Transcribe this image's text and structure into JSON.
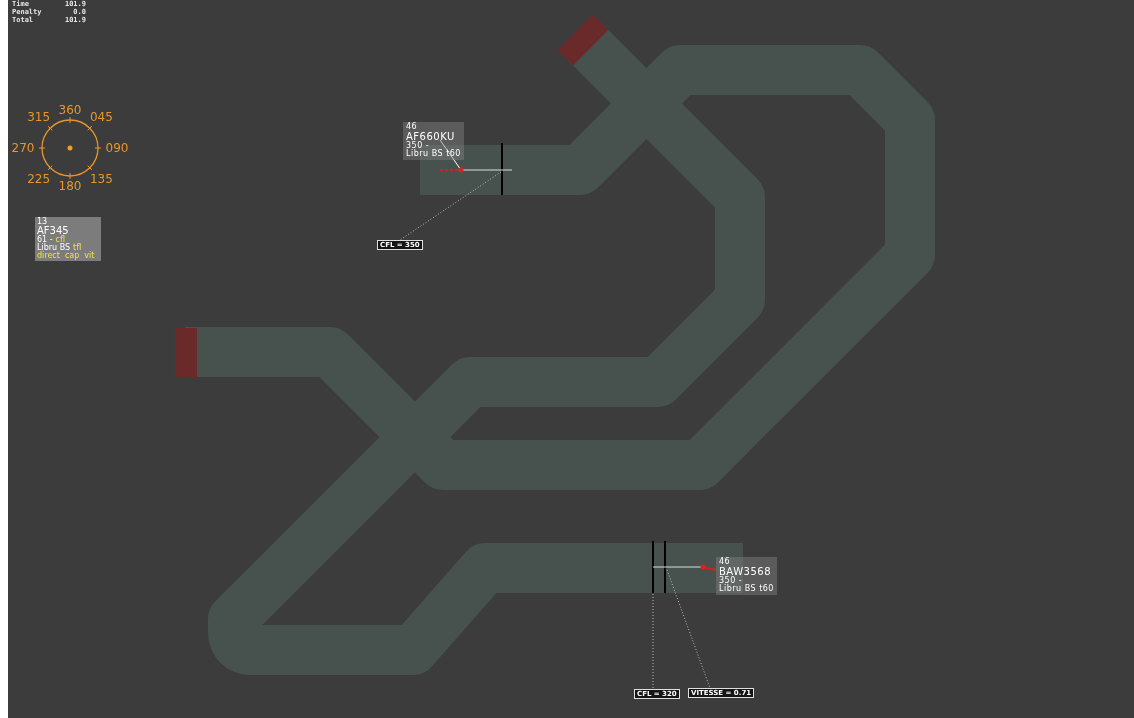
{
  "scoreboard": [
    {
      "label": "Time",
      "value": "101.9"
    },
    {
      "label": "Penalty",
      "value": "0.0"
    },
    {
      "label": "Total",
      "value": "101.9"
    }
  ],
  "compass": {
    "headings": [
      "360",
      "045",
      "090",
      "135",
      "180",
      "225",
      "270",
      "315"
    ]
  },
  "selected_panel": {
    "number": "13",
    "callsign": "AF345",
    "flight_level": "61 -",
    "flight_level_action": "cfl",
    "route": "Libru BS",
    "route_action": "tfl",
    "actions": [
      "direct",
      "cap",
      "vit"
    ]
  },
  "aircraft": [
    {
      "lines": [
        "46",
        "AF660KU",
        "350 -",
        "Libru BS t60"
      ]
    },
    {
      "lines": [
        "46",
        "BAW3568",
        "350 -",
        "Libru BS t60"
      ]
    }
  ],
  "bubbles": [
    {
      "text": "CFL = 350"
    },
    {
      "text": "CFL = 320"
    },
    {
      "text": "VITESSE = 0.71"
    }
  ]
}
